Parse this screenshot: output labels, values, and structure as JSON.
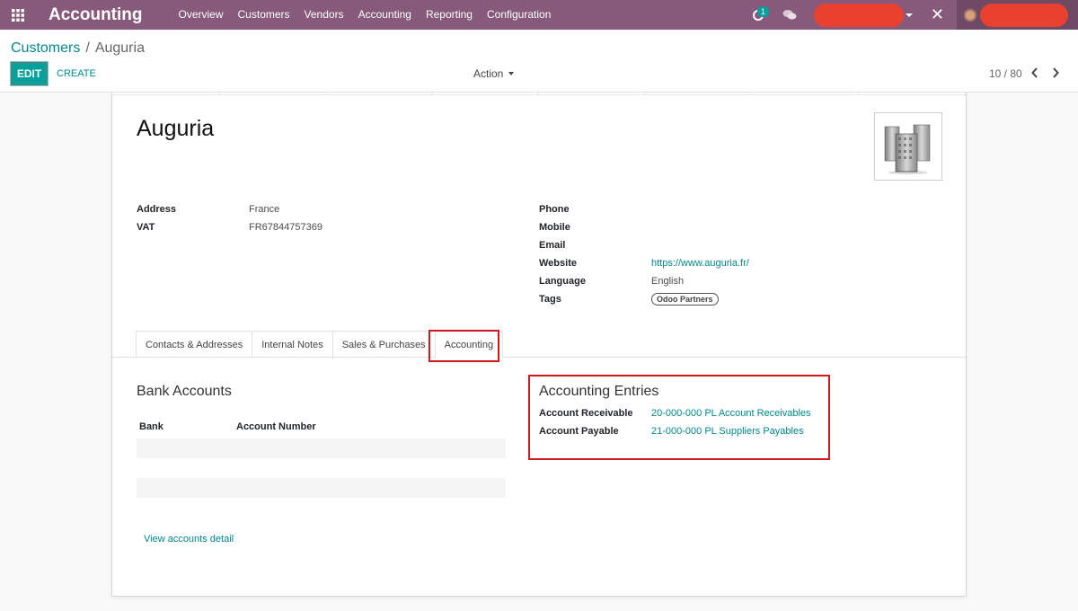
{
  "navbar": {
    "app_name": "Accounting",
    "menu": [
      "Overview",
      "Customers",
      "Vendors",
      "Accounting",
      "Reporting",
      "Configuration"
    ],
    "activity_count": "1",
    "color": "#875a7b"
  },
  "control_panel": {
    "breadcrumb_parent": "Customers",
    "breadcrumb_separator": "/",
    "breadcrumb_current": "Auguria",
    "edit_label": "EDIT",
    "create_label": "CREATE",
    "action_label": "Action",
    "pager": "10 / 80"
  },
  "partner": {
    "name": "Auguria",
    "left_fields": [
      {
        "label": "Address",
        "value": "France"
      },
      {
        "label": "VAT",
        "value": "FR67844757369"
      }
    ],
    "right_fields": {
      "phone_label": "Phone",
      "mobile_label": "Mobile",
      "email_label": "Email",
      "website_label": "Website",
      "website_value": "https://www.auguria.fr/",
      "language_label": "Language",
      "language_value": "English",
      "tags_label": "Tags",
      "tag": "Odoo Partners"
    }
  },
  "tabs": [
    "Contacts & Addresses",
    "Internal Notes",
    "Sales & Purchases",
    "Accounting"
  ],
  "active_tab": "Accounting",
  "bank_accounts": {
    "title": "Bank Accounts",
    "columns": [
      "Bank",
      "Account Number"
    ],
    "view_link": "View accounts detail"
  },
  "accounting_entries": {
    "title": "Accounting Entries",
    "receivable_label": "Account Receivable",
    "receivable_value": "20-000-000 PL Account Receivables",
    "payable_label": "Account Payable",
    "payable_value": "21-000-000 PL Suppliers Payables"
  },
  "colors": {
    "accent": "#00a09d",
    "link": "#00888e",
    "highlight_box": "#d0191d"
  }
}
